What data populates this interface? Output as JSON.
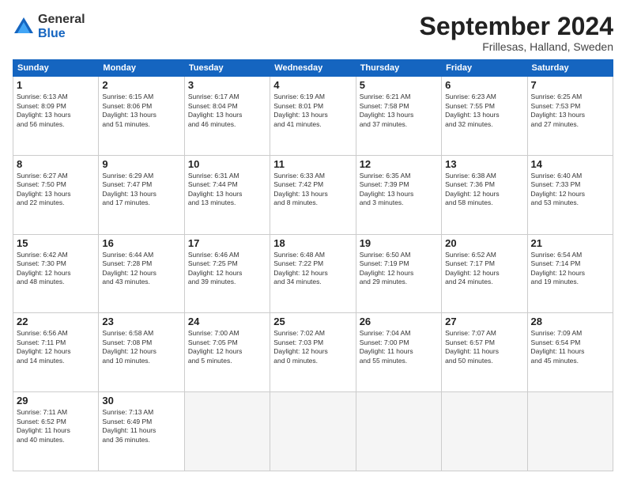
{
  "logo": {
    "general": "General",
    "blue": "Blue"
  },
  "title": "September 2024",
  "subtitle": "Frillesas, Halland, Sweden",
  "days_header": [
    "Sunday",
    "Monday",
    "Tuesday",
    "Wednesday",
    "Thursday",
    "Friday",
    "Saturday"
  ],
  "weeks": [
    [
      {
        "day": "1",
        "text": "Sunrise: 6:13 AM\nSunset: 8:09 PM\nDaylight: 13 hours\nand 56 minutes."
      },
      {
        "day": "2",
        "text": "Sunrise: 6:15 AM\nSunset: 8:06 PM\nDaylight: 13 hours\nand 51 minutes."
      },
      {
        "day": "3",
        "text": "Sunrise: 6:17 AM\nSunset: 8:04 PM\nDaylight: 13 hours\nand 46 minutes."
      },
      {
        "day": "4",
        "text": "Sunrise: 6:19 AM\nSunset: 8:01 PM\nDaylight: 13 hours\nand 41 minutes."
      },
      {
        "day": "5",
        "text": "Sunrise: 6:21 AM\nSunset: 7:58 PM\nDaylight: 13 hours\nand 37 minutes."
      },
      {
        "day": "6",
        "text": "Sunrise: 6:23 AM\nSunset: 7:55 PM\nDaylight: 13 hours\nand 32 minutes."
      },
      {
        "day": "7",
        "text": "Sunrise: 6:25 AM\nSunset: 7:53 PM\nDaylight: 13 hours\nand 27 minutes."
      }
    ],
    [
      {
        "day": "8",
        "text": "Sunrise: 6:27 AM\nSunset: 7:50 PM\nDaylight: 13 hours\nand 22 minutes."
      },
      {
        "day": "9",
        "text": "Sunrise: 6:29 AM\nSunset: 7:47 PM\nDaylight: 13 hours\nand 17 minutes."
      },
      {
        "day": "10",
        "text": "Sunrise: 6:31 AM\nSunset: 7:44 PM\nDaylight: 13 hours\nand 13 minutes."
      },
      {
        "day": "11",
        "text": "Sunrise: 6:33 AM\nSunset: 7:42 PM\nDaylight: 13 hours\nand 8 minutes."
      },
      {
        "day": "12",
        "text": "Sunrise: 6:35 AM\nSunset: 7:39 PM\nDaylight: 13 hours\nand 3 minutes."
      },
      {
        "day": "13",
        "text": "Sunrise: 6:38 AM\nSunset: 7:36 PM\nDaylight: 12 hours\nand 58 minutes."
      },
      {
        "day": "14",
        "text": "Sunrise: 6:40 AM\nSunset: 7:33 PM\nDaylight: 12 hours\nand 53 minutes."
      }
    ],
    [
      {
        "day": "15",
        "text": "Sunrise: 6:42 AM\nSunset: 7:30 PM\nDaylight: 12 hours\nand 48 minutes."
      },
      {
        "day": "16",
        "text": "Sunrise: 6:44 AM\nSunset: 7:28 PM\nDaylight: 12 hours\nand 43 minutes."
      },
      {
        "day": "17",
        "text": "Sunrise: 6:46 AM\nSunset: 7:25 PM\nDaylight: 12 hours\nand 39 minutes."
      },
      {
        "day": "18",
        "text": "Sunrise: 6:48 AM\nSunset: 7:22 PM\nDaylight: 12 hours\nand 34 minutes."
      },
      {
        "day": "19",
        "text": "Sunrise: 6:50 AM\nSunset: 7:19 PM\nDaylight: 12 hours\nand 29 minutes."
      },
      {
        "day": "20",
        "text": "Sunrise: 6:52 AM\nSunset: 7:17 PM\nDaylight: 12 hours\nand 24 minutes."
      },
      {
        "day": "21",
        "text": "Sunrise: 6:54 AM\nSunset: 7:14 PM\nDaylight: 12 hours\nand 19 minutes."
      }
    ],
    [
      {
        "day": "22",
        "text": "Sunrise: 6:56 AM\nSunset: 7:11 PM\nDaylight: 12 hours\nand 14 minutes."
      },
      {
        "day": "23",
        "text": "Sunrise: 6:58 AM\nSunset: 7:08 PM\nDaylight: 12 hours\nand 10 minutes."
      },
      {
        "day": "24",
        "text": "Sunrise: 7:00 AM\nSunset: 7:05 PM\nDaylight: 12 hours\nand 5 minutes."
      },
      {
        "day": "25",
        "text": "Sunrise: 7:02 AM\nSunset: 7:03 PM\nDaylight: 12 hours\nand 0 minutes."
      },
      {
        "day": "26",
        "text": "Sunrise: 7:04 AM\nSunset: 7:00 PM\nDaylight: 11 hours\nand 55 minutes."
      },
      {
        "day": "27",
        "text": "Sunrise: 7:07 AM\nSunset: 6:57 PM\nDaylight: 11 hours\nand 50 minutes."
      },
      {
        "day": "28",
        "text": "Sunrise: 7:09 AM\nSunset: 6:54 PM\nDaylight: 11 hours\nand 45 minutes."
      }
    ],
    [
      {
        "day": "29",
        "text": "Sunrise: 7:11 AM\nSunset: 6:52 PM\nDaylight: 11 hours\nand 40 minutes."
      },
      {
        "day": "30",
        "text": "Sunrise: 7:13 AM\nSunset: 6:49 PM\nDaylight: 11 hours\nand 36 minutes."
      },
      {
        "day": "",
        "text": ""
      },
      {
        "day": "",
        "text": ""
      },
      {
        "day": "",
        "text": ""
      },
      {
        "day": "",
        "text": ""
      },
      {
        "day": "",
        "text": ""
      }
    ]
  ]
}
